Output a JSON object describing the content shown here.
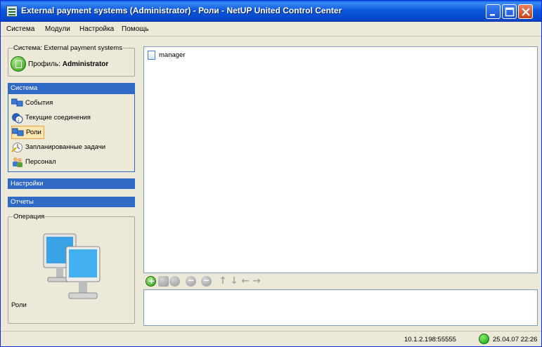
{
  "window": {
    "title": "External payment systems (Administrator) - Роли - NetUP United Control Center",
    "controls": [
      "minimize-icon",
      "maximize-icon",
      "close-icon"
    ]
  },
  "menu": {
    "items": [
      "Система",
      "Модули",
      "Настройка",
      "Помощь"
    ]
  },
  "profile_group": {
    "legend": "Система: External payment systems",
    "profile_label": "Профиль:",
    "profile_value": "Administrator",
    "icon": "calculator-icon"
  },
  "sections": {
    "system": {
      "header": "Система",
      "items": [
        {
          "label": "События",
          "icon": "events-icon"
        },
        {
          "label": "Текущие соединения",
          "icon": "connections-icon"
        },
        {
          "label": "Роли",
          "icon": "roles-icon",
          "selected": true
        },
        {
          "label": "Запланированные задачи",
          "icon": "scheduled-tasks-icon"
        },
        {
          "label": "Персонал",
          "icon": "staff-icon"
        }
      ]
    },
    "settings": {
      "header": "Настройки"
    },
    "reports": {
      "header": "Отчеты"
    }
  },
  "operation": {
    "legend": "Операция",
    "label": "Роли",
    "icon": "computers-icon"
  },
  "roles_list": {
    "rows": [
      {
        "label": "manager",
        "icon": "document-icon"
      }
    ]
  },
  "toolbar": {
    "buttons": [
      {
        "name": "add",
        "icon": "add-icon"
      },
      {
        "name": "edit",
        "icon": "edit-icon"
      },
      {
        "name": "edit-alt",
        "icon": "edit-alt-icon"
      },
      {
        "name": "remove",
        "icon": "remove-icon"
      },
      {
        "name": "remove-alt",
        "icon": "remove-alt-icon"
      },
      {
        "name": "up",
        "icon": "arrow-up-icon"
      },
      {
        "name": "down",
        "icon": "arrow-down-icon"
      },
      {
        "name": "left",
        "icon": "arrow-left-icon"
      },
      {
        "name": "right",
        "icon": "arrow-right-icon"
      }
    ]
  },
  "status": {
    "server": "10.1.2.198:55555",
    "datetime": "25.04.07 22:26",
    "indicator_color": "#12a012"
  },
  "colors": {
    "titlebar": "#0b58dd",
    "section_header": "#316ac5",
    "window_bg": "#ece9d8",
    "selection": "#fbe5b0"
  }
}
